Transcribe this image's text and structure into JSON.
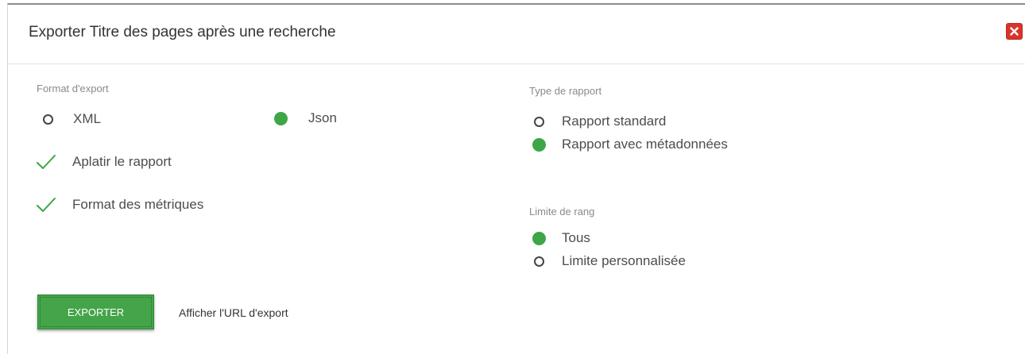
{
  "dialog": {
    "title": "Exporter Titre des pages après une recherche",
    "close_icon": "close-x-icon",
    "close_color": "#d9342b"
  },
  "export_format": {
    "label": "Format d'export",
    "options": [
      {
        "label": "XML",
        "selected": false
      },
      {
        "label": "Json",
        "selected": true
      }
    ]
  },
  "checks": [
    {
      "label": "Aplatir le rapport",
      "checked": true,
      "icon": "checkmark-icon"
    },
    {
      "label": "Format des métriques",
      "checked": true,
      "icon": "checkmark-icon"
    }
  ],
  "report_type": {
    "label": "Type de rapport",
    "options": [
      {
        "label": "Rapport standard",
        "selected": false
      },
      {
        "label": "Rapport avec métadonnées",
        "selected": true
      }
    ]
  },
  "rank_limit": {
    "label": "Limite de rang",
    "options": [
      {
        "label": "Tous",
        "selected": true
      },
      {
        "label": "Limite personnalisée",
        "selected": false
      }
    ]
  },
  "actions": {
    "export_label": "EXPORTER",
    "url_label": "Afficher l'URL d'export"
  },
  "colors": {
    "accent": "#3da646",
    "button": "#44a449",
    "close": "#d9342b"
  }
}
